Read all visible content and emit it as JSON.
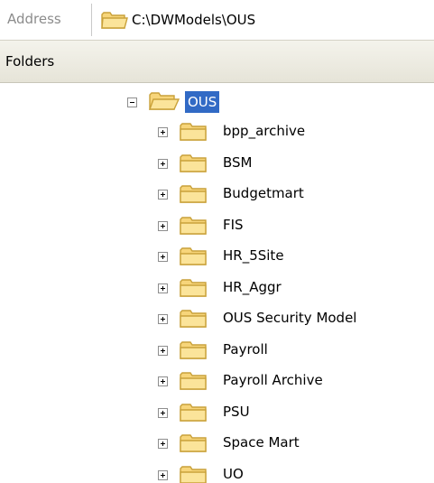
{
  "address_bar": {
    "label": "Address",
    "path": "C:\\DWModels\\OUS"
  },
  "folders_header": {
    "label": "Folders"
  },
  "tree": {
    "root": {
      "label": "OUS",
      "expanded": true,
      "selected": true
    },
    "children": [
      {
        "label": "bpp_archive"
      },
      {
        "label": "BSM"
      },
      {
        "label": "Budgetmart"
      },
      {
        "label": "FIS"
      },
      {
        "label": "HR_5Site"
      },
      {
        "label": "HR_Aggr"
      },
      {
        "label": "OUS Security Model"
      },
      {
        "label": "Payroll"
      },
      {
        "label": "Payroll Archive"
      },
      {
        "label": "PSU"
      },
      {
        "label": "Space Mart"
      },
      {
        "label": "UO"
      }
    ]
  },
  "colors": {
    "selection": "#316ac5",
    "folder_fill": "#f7d57a",
    "folder_stroke": "#c9a13a"
  }
}
